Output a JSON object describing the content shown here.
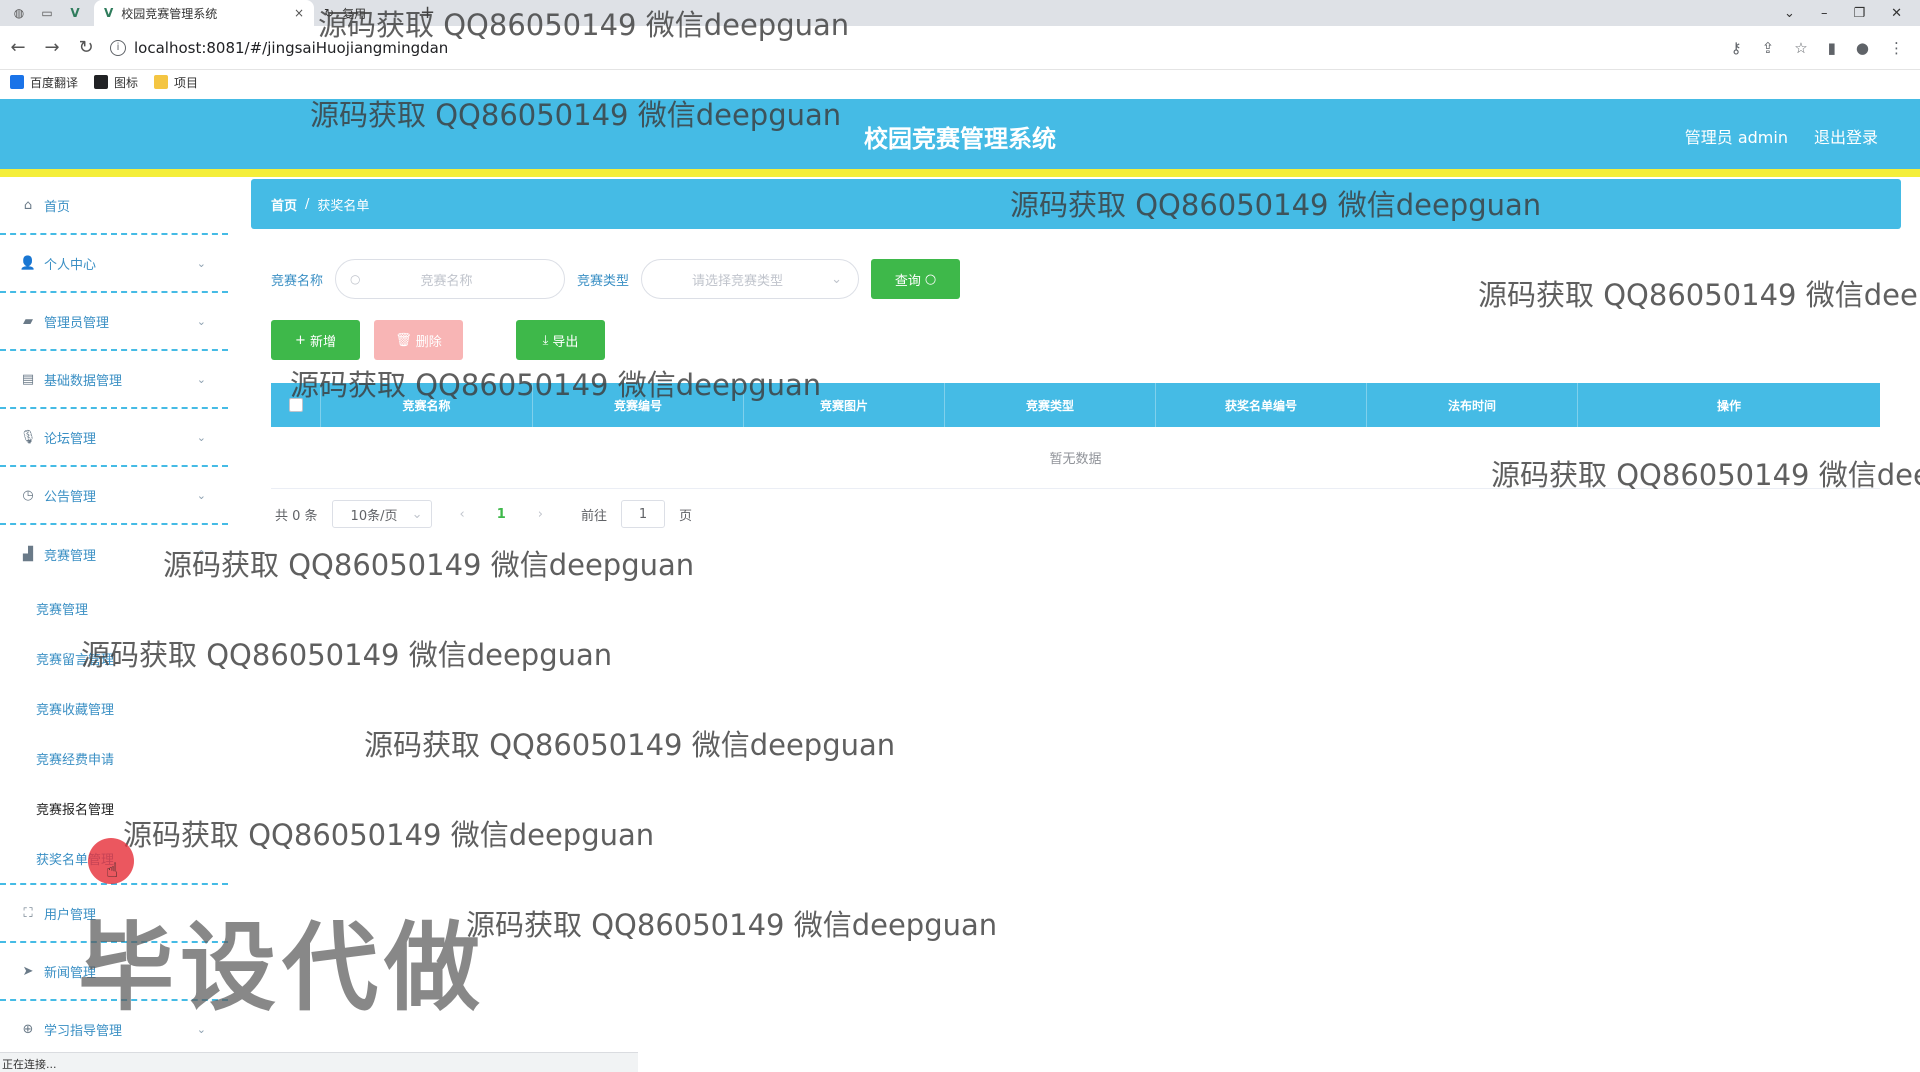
{
  "browser": {
    "tab_title": "校园竞赛管理系统",
    "second_tab": "复用",
    "url": "localhost:8081/#/jingsaiHuojiangmingdan",
    "bookmarks": [
      {
        "label": "百度翻译",
        "color": "#1a73e8"
      },
      {
        "label": "图标",
        "color": "#202124"
      },
      {
        "label": "项目",
        "color": "#f4c542"
      }
    ],
    "status": "正在连接..."
  },
  "header": {
    "title": "校园竞赛管理系统",
    "user": "管理员 admin",
    "logout": "退出登录",
    "colors": {
      "primary": "#45bbe5",
      "accent": "#f4ee3a"
    }
  },
  "sidebar": {
    "items": [
      {
        "label": "首页",
        "icon": "home-icon"
      },
      {
        "label": "个人中心",
        "icon": "user-icon"
      },
      {
        "label": "管理员管理",
        "icon": "admin-icon"
      },
      {
        "label": "基础数据管理",
        "icon": "data-icon"
      },
      {
        "label": "论坛管理",
        "icon": "mic-icon"
      },
      {
        "label": "公告管理",
        "icon": "clock-icon"
      },
      {
        "label": "竞赛管理",
        "icon": "briefcase-icon"
      }
    ],
    "sub_items": [
      "竞赛管理",
      "竞赛留言管理",
      "竞赛收藏管理",
      "竞赛经费申请",
      "竞赛报名管理",
      "获奖名单管理"
    ],
    "bottom_items": [
      {
        "label": "用户管理",
        "icon": "fullscreen-icon"
      },
      {
        "label": "新闻管理",
        "icon": "send-icon"
      },
      {
        "label": "学习指导管理",
        "icon": "compass-icon"
      }
    ]
  },
  "breadcrumb": {
    "home": "首页",
    "separator": "/",
    "current": "获奖名单"
  },
  "filters": {
    "name_label": "竞赛名称",
    "name_placeholder": "竞赛名称",
    "type_label": "竞赛类型",
    "type_placeholder": "请选择竞赛类型",
    "query_button": "查询"
  },
  "actions": {
    "add": "新增",
    "delete": "删除",
    "export": "导出"
  },
  "table": {
    "columns": [
      "竞赛名称",
      "竞赛编号",
      "竞赛图片",
      "竞赛类型",
      "获奖名单编号",
      "法布时间",
      "操作"
    ],
    "empty_text": "暂无数据"
  },
  "pagination": {
    "total": "共 0 条",
    "page_size": "10条/页",
    "current_page": "1",
    "goto_label": "前往",
    "goto_value": "1",
    "page_suffix": "页"
  },
  "watermarks": {
    "text": "源码获取 QQ86050149 微信deepguan",
    "big": "毕设代做"
  }
}
